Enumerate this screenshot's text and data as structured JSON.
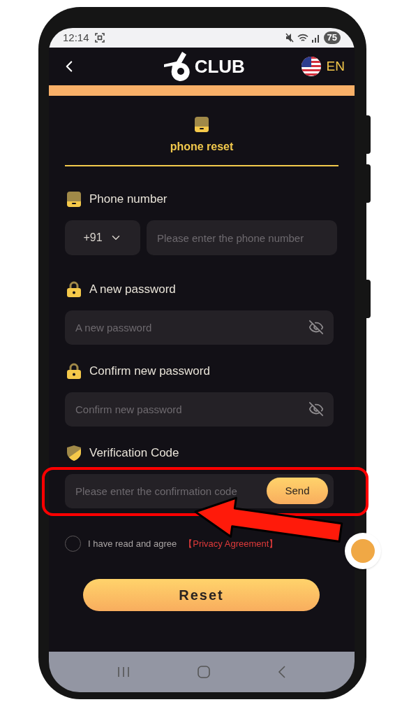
{
  "status_bar": {
    "time": "12:14",
    "battery": "75"
  },
  "header": {
    "logo_text": "CLUB",
    "language": "EN"
  },
  "tab": {
    "label": "phone reset",
    "selected": true
  },
  "fields": [
    {
      "kind": "phone",
      "label": "Phone number",
      "country_code": "+91",
      "placeholder": "Please enter the phone number"
    },
    {
      "kind": "password",
      "label": "A new password",
      "placeholder": "A new password"
    },
    {
      "kind": "password",
      "label": "Confirm new password",
      "placeholder": "Confirm new password"
    },
    {
      "kind": "code",
      "label": "Verification Code",
      "placeholder": "Please enter the confirmation code",
      "button": "Send"
    }
  ],
  "agreement": {
    "checked": false,
    "text": "I have read and agree",
    "link": "【Privacy Agreement】"
  },
  "submit": "Reset"
}
